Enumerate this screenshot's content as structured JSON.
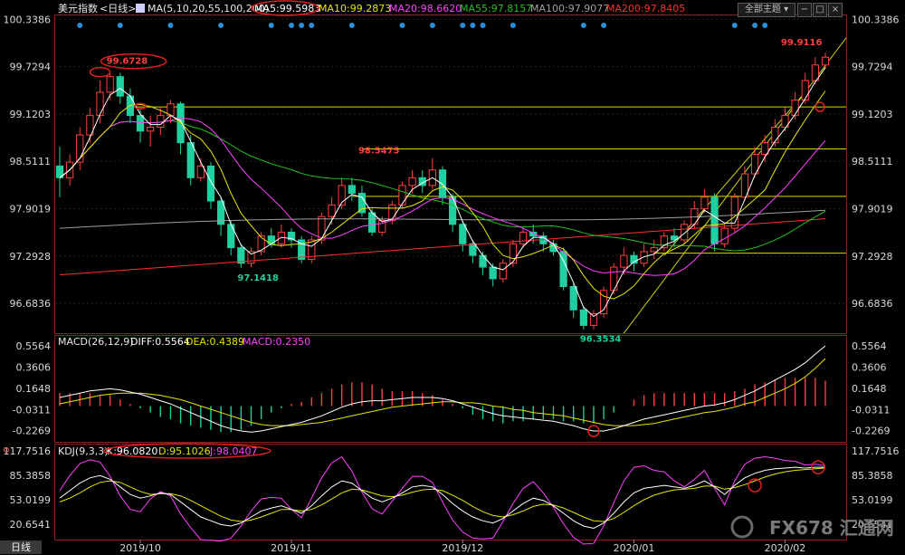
{
  "header": {
    "symbol": "美元指数",
    "period": "<日线>",
    "ma_label": "MA(5,10,20,55,100,200)",
    "ma5": "MA5:99.5983",
    "ma10": "MA10:99.2873",
    "ma20": "MA20:98.6620",
    "ma55": "MA55:97.8157",
    "ma100": "MA100:97.9077",
    "ma200": "MA200:97.8405",
    "theme_button": "全部主题"
  },
  "colors": {
    "up": "#ff4040",
    "down": "#20d0a0",
    "ma5": "#ffffff",
    "ma10": "#e6e600",
    "ma20": "#ff40ff",
    "ma55": "#20c020",
    "ma100": "#a0a0a0",
    "ma200": "#ff3030"
  },
  "macd": {
    "label": "MACD(26,12,9)",
    "diff": "DIFF:0.5564",
    "dea": "DEA:0.4389",
    "macd": "MACD:0.2350"
  },
  "kdj": {
    "label": "KDJ(9,3,3)",
    "k": "K:96.0820",
    "d": "D:95.1026",
    "j": "J:98.0407"
  },
  "footer": {
    "tab": "日线",
    "watermark": "FX678 汇通网"
  },
  "chart_data": [
    {
      "type": "candlestick",
      "name": "price",
      "y_ticks": [
        "100.3386",
        "99.7294",
        "99.1203",
        "98.5111",
        "97.9019",
        "97.2928",
        "96.6836"
      ],
      "ylim": [
        96.3,
        100.4
      ],
      "x_ticks": [
        "2019/10",
        "2019/11",
        "2019/12",
        "2020/01",
        "2020/02"
      ],
      "annotations": [
        "99.6728",
        "98.5475",
        "97.1418",
        "96.3534",
        "99.9116"
      ],
      "trend_levels": [
        99.21,
        98.67,
        98.06,
        97.33
      ],
      "candles": [
        [
          98.45,
          98.3,
          98.05,
          98.7
        ],
        [
          98.3,
          98.5,
          98.2,
          98.6
        ],
        [
          98.5,
          98.85,
          98.4,
          98.95
        ],
        [
          98.85,
          99.1,
          98.75,
          99.2
        ],
        [
          99.1,
          99.4,
          99.0,
          99.55
        ],
        [
          99.4,
          99.6,
          99.3,
          99.67
        ],
        [
          99.6,
          99.35,
          99.25,
          99.65
        ],
        [
          99.35,
          99.1,
          99.0,
          99.45
        ],
        [
          99.1,
          98.9,
          98.75,
          99.2
        ],
        [
          98.9,
          98.95,
          98.7,
          99.1
        ],
        [
          98.95,
          99.1,
          98.85,
          99.2
        ],
        [
          99.1,
          99.25,
          99.0,
          99.3
        ],
        [
          99.25,
          98.75,
          98.6,
          99.28
        ],
        [
          98.75,
          98.3,
          98.2,
          98.85
        ],
        [
          98.3,
          98.45,
          98.25,
          98.55
        ],
        [
          98.45,
          98.0,
          97.9,
          98.5
        ],
        [
          98.0,
          97.7,
          97.55,
          98.05
        ],
        [
          97.7,
          97.4,
          97.3,
          97.75
        ],
        [
          97.4,
          97.2,
          97.14,
          97.45
        ],
        [
          97.2,
          97.35,
          97.15,
          97.4
        ],
        [
          97.35,
          97.55,
          97.3,
          97.6
        ],
        [
          97.55,
          97.45,
          97.4,
          97.65
        ],
        [
          97.45,
          97.6,
          97.4,
          97.7
        ],
        [
          97.6,
          97.5,
          97.4,
          97.65
        ],
        [
          97.5,
          97.25,
          97.2,
          97.55
        ],
        [
          97.25,
          97.5,
          97.2,
          97.55
        ],
        [
          97.5,
          97.8,
          97.45,
          97.85
        ],
        [
          97.8,
          97.95,
          97.7,
          98.05
        ],
        [
          97.95,
          98.2,
          97.9,
          98.3
        ],
        [
          98.2,
          98.1,
          98.0,
          98.3
        ],
        [
          98.1,
          97.85,
          97.8,
          98.2
        ],
        [
          97.85,
          97.6,
          97.55,
          97.9
        ],
        [
          97.6,
          97.75,
          97.55,
          97.8
        ],
        [
          97.75,
          97.95,
          97.7,
          98.0
        ],
        [
          97.95,
          98.2,
          97.9,
          98.25
        ],
        [
          98.2,
          98.3,
          98.1,
          98.4
        ],
        [
          98.3,
          98.2,
          98.1,
          98.4
        ],
        [
          98.2,
          98.4,
          98.15,
          98.55
        ],
        [
          98.4,
          98.05,
          97.95,
          98.45
        ],
        [
          98.05,
          97.7,
          97.6,
          98.1
        ],
        [
          97.7,
          97.45,
          97.35,
          97.75
        ],
        [
          97.45,
          97.3,
          97.2,
          97.5
        ],
        [
          97.3,
          97.15,
          97.05,
          97.35
        ],
        [
          97.15,
          97.0,
          96.9,
          97.2
        ],
        [
          97.0,
          97.2,
          96.95,
          97.25
        ],
        [
          97.2,
          97.45,
          97.15,
          97.5
        ],
        [
          97.45,
          97.6,
          97.4,
          97.65
        ],
        [
          97.6,
          97.55,
          97.45,
          97.7
        ],
        [
          97.55,
          97.45,
          97.35,
          97.6
        ],
        [
          97.45,
          97.35,
          97.3,
          97.5
        ],
        [
          97.35,
          96.9,
          96.85,
          97.4
        ],
        [
          96.9,
          96.6,
          96.5,
          96.95
        ],
        [
          96.6,
          96.4,
          96.35,
          96.65
        ],
        [
          96.4,
          96.55,
          96.35,
          96.6
        ],
        [
          96.55,
          96.85,
          96.5,
          96.9
        ],
        [
          96.85,
          97.15,
          96.8,
          97.2
        ],
        [
          97.15,
          97.3,
          97.05,
          97.4
        ],
        [
          97.3,
          97.2,
          97.1,
          97.35
        ],
        [
          97.2,
          97.35,
          97.15,
          97.45
        ],
        [
          97.35,
          97.4,
          97.25,
          97.5
        ],
        [
          97.4,
          97.55,
          97.35,
          97.6
        ],
        [
          97.55,
          97.5,
          97.4,
          97.65
        ],
        [
          97.5,
          97.7,
          97.45,
          97.75
        ],
        [
          97.7,
          97.9,
          97.65,
          98.0
        ],
        [
          97.9,
          98.05,
          97.85,
          98.15
        ],
        [
          98.05,
          97.45,
          97.35,
          98.1
        ],
        [
          97.45,
          97.65,
          97.4,
          97.7
        ],
        [
          97.65,
          98.05,
          97.6,
          98.1
        ],
        [
          98.05,
          98.35,
          98.0,
          98.45
        ],
        [
          98.35,
          98.6,
          98.3,
          98.7
        ],
        [
          98.6,
          98.75,
          98.5,
          98.85
        ],
        [
          98.75,
          98.95,
          98.7,
          99.05
        ],
        [
          98.95,
          99.1,
          98.9,
          99.2
        ],
        [
          99.1,
          99.3,
          99.05,
          99.4
        ],
        [
          99.3,
          99.55,
          99.25,
          99.65
        ],
        [
          99.55,
          99.75,
          99.5,
          99.85
        ],
        [
          99.75,
          99.85,
          99.7,
          99.91
        ]
      ]
    },
    {
      "type": "macd",
      "name": "MACD(26,12,9)",
      "y_ticks": [
        "0.5564",
        "0.3606",
        "0.1648",
        "-0.0311",
        "-0.2269"
      ],
      "ylim": [
        -0.33,
        0.64
      ],
      "diff": [
        0.08,
        0.1,
        0.12,
        0.14,
        0.15,
        0.16,
        0.15,
        0.13,
        0.11,
        0.08,
        0.05,
        0.02,
        -0.02,
        -0.06,
        -0.1,
        -0.14,
        -0.18,
        -0.21,
        -0.23,
        -0.24,
        -0.23,
        -0.21,
        -0.19,
        -0.17,
        -0.15,
        -0.12,
        -0.09,
        -0.05,
        -0.01,
        0.02,
        0.04,
        0.05,
        0.05,
        0.06,
        0.07,
        0.08,
        0.08,
        0.08,
        0.07,
        0.05,
        0.02,
        -0.01,
        -0.04,
        -0.07,
        -0.09,
        -0.1,
        -0.11,
        -0.12,
        -0.13,
        -0.14,
        -0.16,
        -0.18,
        -0.21,
        -0.23,
        -0.23,
        -0.21,
        -0.18,
        -0.15,
        -0.12,
        -0.1,
        -0.08,
        -0.06,
        -0.04,
        -0.02,
        0.0,
        0.01,
        0.03,
        0.06,
        0.1,
        0.14,
        0.19,
        0.24,
        0.29,
        0.34,
        0.4,
        0.48,
        0.556
      ],
      "dea": [
        0.02,
        0.04,
        0.06,
        0.08,
        0.1,
        0.11,
        0.12,
        0.12,
        0.12,
        0.11,
        0.1,
        0.08,
        0.06,
        0.03,
        0.0,
        -0.03,
        -0.06,
        -0.09,
        -0.12,
        -0.15,
        -0.17,
        -0.18,
        -0.18,
        -0.18,
        -0.17,
        -0.16,
        -0.15,
        -0.13,
        -0.11,
        -0.09,
        -0.07,
        -0.05,
        -0.03,
        -0.01,
        0.0,
        0.01,
        0.02,
        0.03,
        0.04,
        0.04,
        0.03,
        0.03,
        0.02,
        0.0,
        -0.01,
        -0.03,
        -0.04,
        -0.06,
        -0.07,
        -0.08,
        -0.09,
        -0.11,
        -0.13,
        -0.15,
        -0.17,
        -0.18,
        -0.18,
        -0.18,
        -0.17,
        -0.16,
        -0.14,
        -0.12,
        -0.1,
        -0.08,
        -0.06,
        -0.05,
        -0.03,
        -0.01,
        0.02,
        0.04,
        0.08,
        0.12,
        0.16,
        0.21,
        0.27,
        0.35,
        0.439
      ]
    },
    {
      "type": "kdj",
      "name": "KDJ(9,3,3)",
      "y_ticks": [
        "117.7516",
        "85.3858",
        "53.0199",
        "20.6541"
      ],
      "ylim": [
        0,
        125
      ],
      "k": [
        55,
        65,
        75,
        82,
        85,
        80,
        70,
        60,
        55,
        58,
        62,
        60,
        50,
        40,
        30,
        25,
        20,
        18,
        22,
        30,
        38,
        42,
        45,
        40,
        35,
        45,
        58,
        70,
        78,
        75,
        65,
        55,
        50,
        55,
        62,
        70,
        72,
        70,
        60,
        48,
        38,
        30,
        25,
        22,
        28,
        38,
        48,
        55,
        52,
        45,
        35,
        25,
        18,
        15,
        22,
        35,
        50,
        62,
        68,
        70,
        72,
        70,
        68,
        72,
        78,
        70,
        60,
        72,
        82,
        88,
        92,
        94,
        95,
        96,
        95,
        96,
        96
      ],
      "d": [
        50,
        55,
        62,
        70,
        76,
        78,
        76,
        70,
        64,
        60,
        61,
        61,
        58,
        52,
        45,
        38,
        31,
        26,
        24,
        26,
        30,
        35,
        40,
        40,
        38,
        40,
        46,
        54,
        62,
        67,
        66,
        62,
        58,
        57,
        59,
        63,
        66,
        67,
        65,
        59,
        52,
        44,
        37,
        32,
        30,
        33,
        38,
        44,
        47,
        46,
        42,
        36,
        30,
        25,
        24,
        28,
        36,
        45,
        53,
        59,
        63,
        66,
        67,
        68,
        71,
        71,
        67,
        69,
        73,
        78,
        83,
        87,
        90,
        92,
        93,
        94,
        95.1
      ],
      "j": [
        65,
        85,
        101,
        106,
        103,
        84,
        58,
        40,
        37,
        54,
        64,
        58,
        34,
        16,
        0,
        -1,
        -2,
        2,
        18,
        38,
        54,
        56,
        55,
        40,
        29,
        55,
        82,
        102,
        110,
        91,
        63,
        41,
        34,
        51,
        68,
        84,
        84,
        76,
        50,
        26,
        10,
        2,
        1,
        2,
        24,
        48,
        68,
        77,
        62,
        43,
        21,
        3,
        -6,
        -5,
        18,
        49,
        78,
        96,
        98,
        92,
        90,
        78,
        70,
        80,
        92,
        68,
        46,
        78,
        100,
        108,
        110,
        108,
        105,
        104,
        99,
        100,
        98
      ]
    }
  ]
}
